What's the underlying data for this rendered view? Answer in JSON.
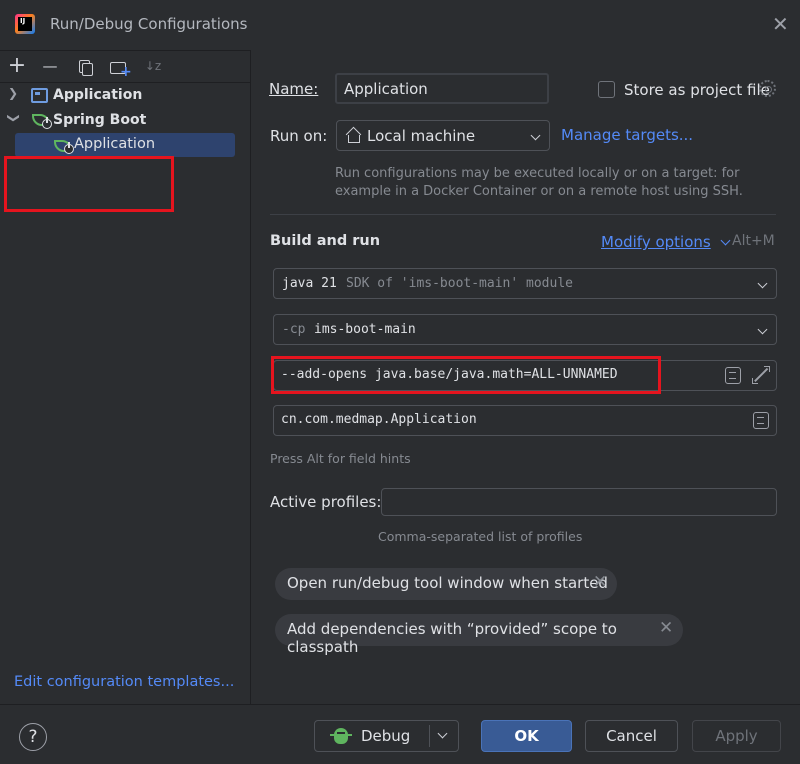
{
  "window": {
    "title": "Run/Debug Configurations",
    "app_icon_text": "IJ"
  },
  "left": {
    "toolbar": {
      "add": "+",
      "remove": "—",
      "copy": "⧉",
      "new_folder": "+",
      "sort": "↓z"
    },
    "tree": [
      {
        "label": "Application",
        "expanded": false
      },
      {
        "label": "Spring Boot",
        "expanded": true,
        "children": [
          {
            "label": "Application",
            "selected": true
          }
        ]
      }
    ],
    "edit_templates_link": "Edit configuration templates..."
  },
  "form": {
    "name_label": "Name:",
    "name_value": "Application",
    "store_label": "Store as project file",
    "store_checked": false,
    "run_on_label": "Run on:",
    "run_on_value": "Local machine",
    "manage_targets": "Manage targets...",
    "run_on_hint_1": "Run configurations may be executed locally or on a target: for",
    "run_on_hint_2": "example in a Docker Container or on a remote host using SSH.",
    "build_run_title": "Build and run",
    "modify_options": "Modify options",
    "modify_shortcut": "Alt+M",
    "jdk_main": "java 21",
    "jdk_suffix": "SDK of 'ims-boot-main' module",
    "cp_prefix": "-cp",
    "cp_value": "ims-boot-main",
    "vm_options": "--add-opens java.base/java.math=ALL-UNNAMED",
    "main_class": "cn.com.medmap.Application",
    "field_hints": "Press Alt for field hints",
    "active_profiles_label": "Active profiles:",
    "active_profiles_value": "",
    "profiles_hint": "Comma-separated list of profiles",
    "chips": [
      "Open run/debug tool window when started",
      "Add dependencies with “provided” scope to classpath"
    ]
  },
  "footer": {
    "help": "?",
    "debug": "Debug",
    "ok": "OK",
    "cancel": "Cancel",
    "apply": "Apply"
  },
  "colors": {
    "accent_link": "#548af7",
    "highlight_box": "#e5141e",
    "selection": "#2e436e",
    "spring": "#5fb55f"
  }
}
